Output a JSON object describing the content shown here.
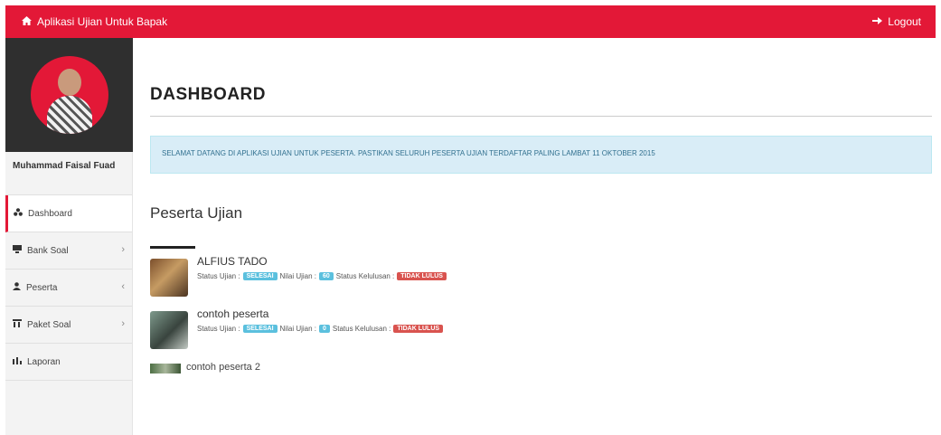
{
  "header": {
    "title": "Aplikasi Ujian Untuk Bapak",
    "logout_label": "Logout",
    "accent": "#e31837"
  },
  "sidebar": {
    "username": "Muhammad Faisal Fuad",
    "items": [
      {
        "label": "Dashboard",
        "icon": "dashboard-icon",
        "active": true
      },
      {
        "label": "Bank Soal",
        "icon": "book-icon",
        "chevron": "›"
      },
      {
        "label": "Peserta",
        "icon": "user-icon",
        "chevron": "‹"
      },
      {
        "label": "Paket Soal",
        "icon": "paket-icon",
        "chevron": "›"
      },
      {
        "label": "Laporan",
        "icon": "report-icon"
      }
    ]
  },
  "main": {
    "page_title": "DASHBOARD",
    "alert": "SELAMAT DATANG DI APLIKASI UJIAN UNTUK PESERTA. PASTIKAN SELURUH PESERTA UJIAN TERDAFTAR PALING LAMBAT 11 OKTOBER 2015",
    "section_title": "Peserta Ujian",
    "participants": [
      {
        "name": "ALFIUS TADO",
        "status_ujian_label": "Status Ujian :",
        "status_ujian": "SELESAI",
        "nilai_label": "Nilai Ujian :",
        "nilai": "60",
        "status_kelulusan_label": "Status Kelulusan :",
        "status_kelulusan": "TIDAK LULUS"
      },
      {
        "name": "contoh peserta",
        "status_ujian_label": "Status Ujian :",
        "status_ujian": "SELESAI",
        "nilai_label": "Nilai Ujian :",
        "nilai": "0",
        "status_kelulusan_label": "Status Kelulusan :",
        "status_kelulusan": "TIDAK LULUS"
      },
      {
        "name": "contoh peserta 2"
      }
    ]
  }
}
